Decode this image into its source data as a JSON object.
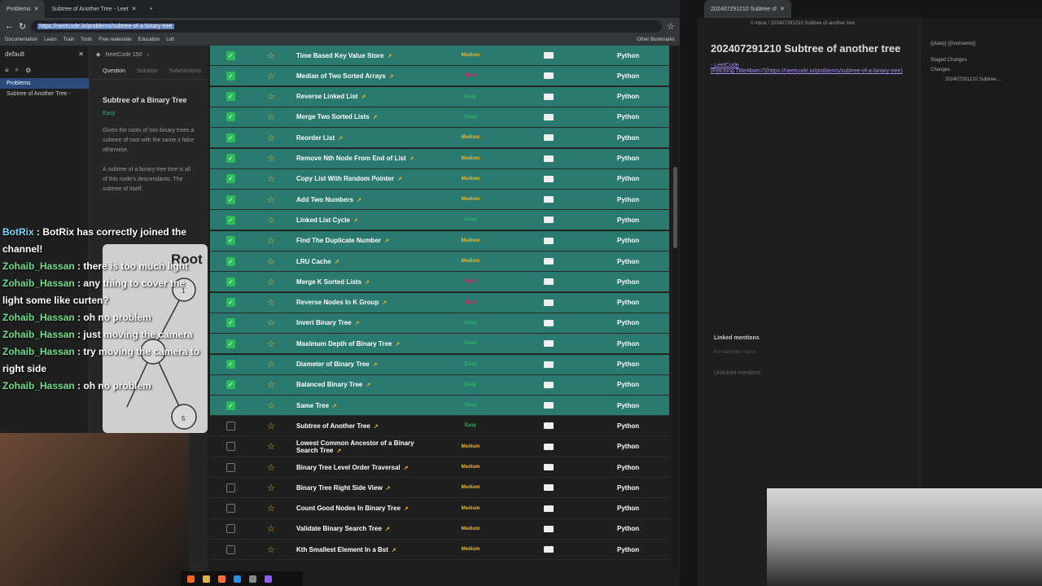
{
  "browser": {
    "tabs": [
      {
        "title": "Problems"
      },
      {
        "title": "Subtree of Another Tree - Leet"
      }
    ],
    "url": "https://neetcode.io/problems/subtree-of-a-binary-tree",
    "bookmarks": [
      "Documentation",
      "Learn",
      "Train",
      "Tools",
      "Free realestate",
      "Education",
      "Lofi",
      "Other Bookmarks"
    ]
  },
  "sidebar": {
    "profile": "default",
    "items": [
      {
        "label": "Problems"
      },
      {
        "label": "Subtree of Another Tree -"
      }
    ]
  },
  "neetcode": {
    "brand": "NeetCode 150",
    "tabs": [
      "Question",
      "Solution",
      "Submissions"
    ],
    "title": "Subtree of a Binary Tree",
    "difficulty": "Easy",
    "text1": "Given the roots of two binary trees a subtree of root with the same s false otherwise.",
    "text2": "A subtree of a binary tree tree is all of this node's descendants. The subtree of itself."
  },
  "chat": [
    {
      "user": "BotRix",
      "msg": "BotRix has correctly joined the channel!"
    },
    {
      "user": "Zohaib_Hassan",
      "msg": "there is too much light"
    },
    {
      "user": "Zohaib_Hassan",
      "msg": "any thing to cover the light some like curten?"
    },
    {
      "user": "Zohaib_Hassan",
      "msg": "oh no problem"
    },
    {
      "user": "Zohaib_Hassan",
      "msg": "just moving the camera"
    },
    {
      "user": "Zohaib_Hassan",
      "msg": "try moving the camera to right side"
    },
    {
      "user": "Zohaib_Hassan",
      "msg": "oh no problem"
    }
  ],
  "tree_label": "Root",
  "tree_nodes": [
    "1",
    "5"
  ],
  "problems": [
    {
      "name": "Time Based Key Value Store",
      "difficulty": "Medium",
      "lang": "Python",
      "done": true
    },
    {
      "name": "Median of Two Sorted Arrays",
      "difficulty": "Hard",
      "lang": "Python",
      "done": true
    },
    {
      "name": "Reverse Linked List",
      "difficulty": "Easy",
      "lang": "Python",
      "done": true
    },
    {
      "name": "Merge Two Sorted Lists",
      "difficulty": "Easy",
      "lang": "Python",
      "done": true
    },
    {
      "name": "Reorder List",
      "difficulty": "Medium",
      "lang": "Python",
      "done": true
    },
    {
      "name": "Remove Nth Node From End of List",
      "difficulty": "Medium",
      "lang": "Python",
      "done": true
    },
    {
      "name": "Copy List With Random Pointer",
      "difficulty": "Medium",
      "lang": "Python",
      "done": true
    },
    {
      "name": "Add Two Numbers",
      "difficulty": "Medium",
      "lang": "Python",
      "done": true
    },
    {
      "name": "Linked List Cycle",
      "difficulty": "Easy",
      "lang": "Python",
      "done": true
    },
    {
      "name": "Find The Duplicate Number",
      "difficulty": "Medium",
      "lang": "Python",
      "done": true
    },
    {
      "name": "LRU Cache",
      "difficulty": "Medium",
      "lang": "Python",
      "done": true
    },
    {
      "name": "Merge K Sorted Lists",
      "difficulty": "Hard",
      "lang": "Python",
      "done": true
    },
    {
      "name": "Reverse Nodes In K Group",
      "difficulty": "Hard",
      "lang": "Python",
      "done": true
    },
    {
      "name": "Invert Binary Tree",
      "difficulty": "Easy",
      "lang": "Python",
      "done": true
    },
    {
      "name": "Maximum Depth of Binary Tree",
      "difficulty": "Easy",
      "lang": "Python",
      "done": true
    },
    {
      "name": "Diameter of Binary Tree",
      "difficulty": "Easy",
      "lang": "Python",
      "done": true
    },
    {
      "name": "Balanced Binary Tree",
      "difficulty": "Easy",
      "lang": "Python",
      "done": true
    },
    {
      "name": "Same Tree",
      "difficulty": "Easy",
      "lang": "Python",
      "done": true
    },
    {
      "name": "Subtree of Another Tree",
      "difficulty": "Easy",
      "lang": "Python",
      "done": false
    },
    {
      "name": "Lowest Common Ancestor of a Binary Search Tree",
      "difficulty": "Medium",
      "lang": "Python",
      "done": false
    },
    {
      "name": "Binary Tree Level Order Traversal",
      "difficulty": "Medium",
      "lang": "Python",
      "done": false
    },
    {
      "name": "Binary Tree Right Side View",
      "difficulty": "Medium",
      "lang": "Python",
      "done": false
    },
    {
      "name": "Count Good Nodes In Binary Tree",
      "difficulty": "Medium",
      "lang": "Python",
      "done": false
    },
    {
      "name": "Validate Binary Search Tree",
      "difficulty": "Medium",
      "lang": "Python",
      "done": false
    },
    {
      "name": "Kth Smallest Element In a Bst",
      "difficulty": "Medium",
      "lang": "Python",
      "done": false
    }
  ],
  "obsidian": {
    "tab": "202407291210 Subtree of",
    "breadcrumb": "0-inbox / 202407291210 Subtree of another tree",
    "title": "202407291210 Subtree of another tree",
    "link1": "- LeetCode",
    "link2": "[Fetching Title#kwm7](https://neetcode.io/problems/subtree-of-a-binary-tree)",
    "linked_mentions": "Linked mentions",
    "no_backlinks": "No backlinks found.",
    "unlinked_mentions": "Unlinked mentions",
    "git_template": "{{date}} {{hostname}}",
    "staged": "Staged Changes",
    "changes": "Changes",
    "changed_file": "202407291210 Subtree ..."
  }
}
